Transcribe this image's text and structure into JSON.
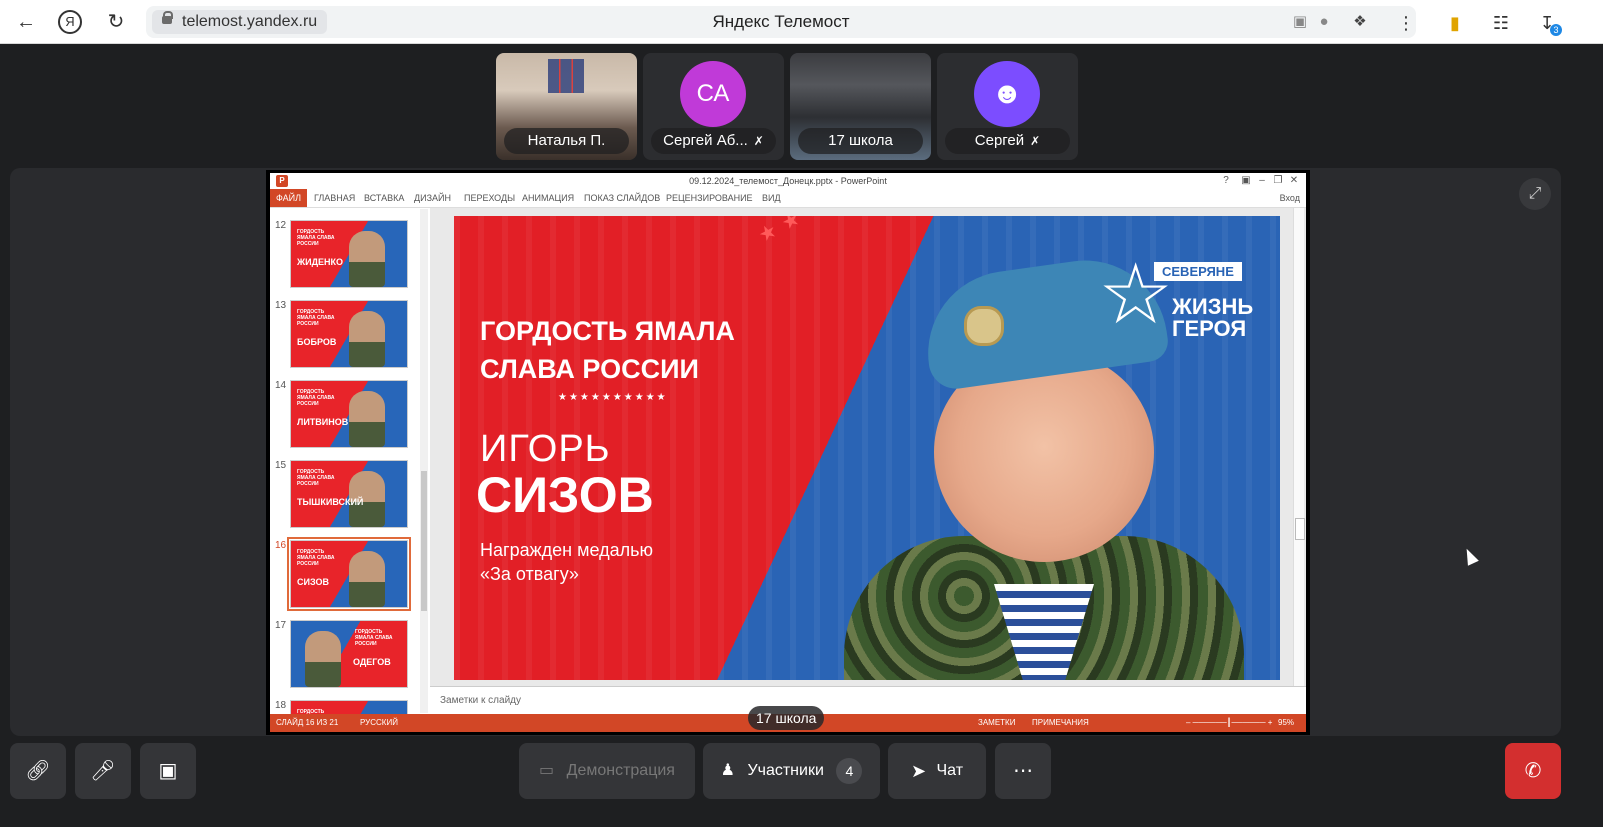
{
  "browser": {
    "url": "telemost.yandex.ru",
    "page_title": "Яндекс Телемост",
    "downloads_badge": "3"
  },
  "participants": [
    {
      "name": "Наталья П.",
      "type": "video"
    },
    {
      "name": "Сергей Аб...",
      "initials": "СА",
      "avatar_color": "#c03ad8",
      "muted": true
    },
    {
      "name": "17 школа",
      "type": "video"
    },
    {
      "name": "Сергей",
      "avatar_color": "#7c4dff",
      "muted": true
    }
  ],
  "powerpoint": {
    "window_title": "09.12.2024_телемост_Донецк.pptx - PowerPoint",
    "login": "Вход",
    "tabs": [
      "ФАЙЛ",
      "ГЛАВНАЯ",
      "ВСТАВКА",
      "ДИЗАЙН",
      "ПЕРЕХОДЫ",
      "АНИМАЦИЯ",
      "ПОКАЗ СЛАЙДОВ",
      "РЕЦЕНЗИРОВАНИЕ",
      "ВИД"
    ],
    "thumbnails": [
      {
        "num": "12",
        "name": "ЖИДЕНКО"
      },
      {
        "num": "13",
        "name": "БОБРОВ"
      },
      {
        "num": "14",
        "name": "ЛИТВИНОВ"
      },
      {
        "num": "15",
        "name": "ТЫШКИВСКИЙ"
      },
      {
        "num": "16",
        "name": "СИЗОВ",
        "selected": true
      },
      {
        "num": "17",
        "name": "ОДЕГОВ"
      },
      {
        "num": "18",
        "name": ""
      }
    ],
    "thumb_heading": "ГОРДОСТЬ ЯМАЛА СЛАВА РОССИИ",
    "slide": {
      "line1": "ГОРДОСТЬ ЯМАЛА",
      "line2": "СЛАВА РОССИИ",
      "dots": "★★★★★★★★★★",
      "first_name": "ИГОРЬ",
      "last_name": "СИЗОВ",
      "award_line1": "Награжден медалью",
      "award_line2": "«За отвагу»",
      "logo_top": "СЕВЕРЯНЕ",
      "logo_line1": "ЖИЗНЬ",
      "logo_line2": "ГЕРОЯ",
      "colors": {
        "red": "#e21f26",
        "blue": "#2a64b5"
      }
    },
    "notes_placeholder": "Заметки к слайду",
    "status": {
      "slide": "СЛАЙД 16 ИЗ 21",
      "language": "РУССКИЙ",
      "notes": "ЗАМЕТКИ",
      "comments": "ПРИМЕЧАНИЯ",
      "zoom": "95%"
    }
  },
  "presenter_label": "17 школа",
  "controls": {
    "demo": "Демонстрация",
    "participants": "Участники",
    "participants_count": "4",
    "chat": "Чат"
  }
}
